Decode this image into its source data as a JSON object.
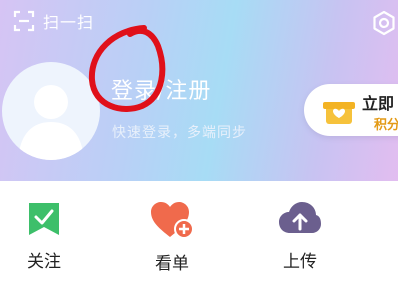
{
  "header": {
    "scan_label": "扫一扫",
    "login_title": "登录/注册",
    "login_subtitle": "快速登录，多端同步"
  },
  "promo": {
    "main_label": "立即",
    "sub_label": "积分"
  },
  "quick_actions": [
    {
      "label": "关注",
      "icon": "bookmark-check-icon",
      "color": "#3dbf6a"
    },
    {
      "label": "看单",
      "icon": "heart-plus-icon",
      "color": "#f06a4c"
    },
    {
      "label": "上传",
      "icon": "cloud-upload-icon",
      "color": "#6b5f8e"
    }
  ],
  "colors": {
    "annotation_red": "#e0101a",
    "promo_accent": "#e39a16"
  }
}
